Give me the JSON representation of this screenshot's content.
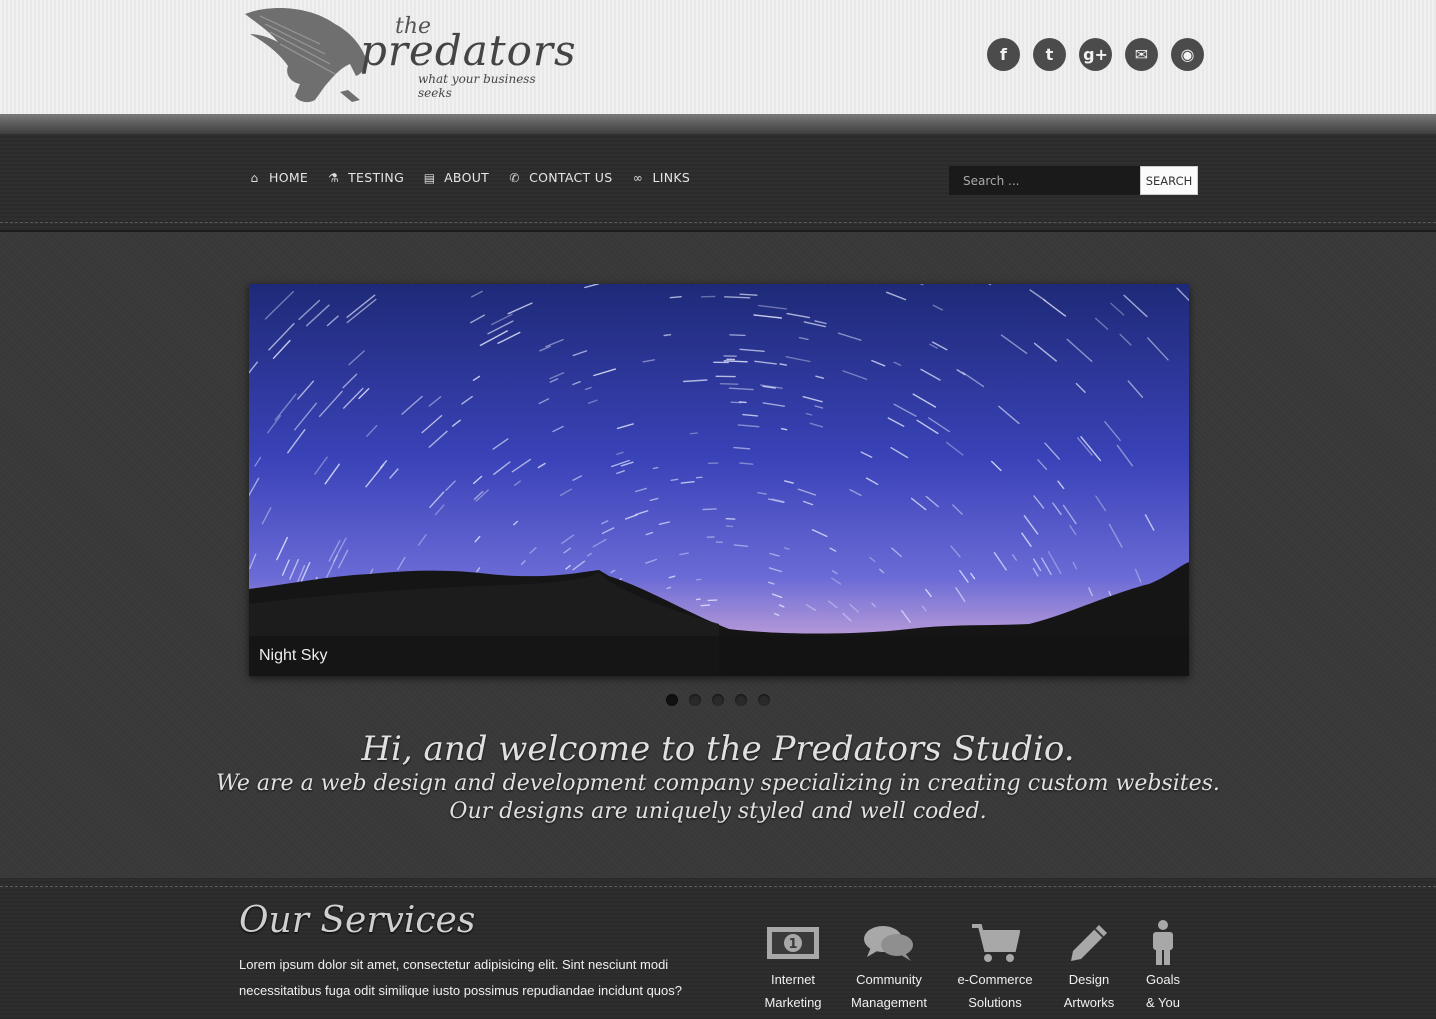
{
  "logo": {
    "the": "the",
    "name": "predators",
    "tagline": "what your business seeks"
  },
  "social": [
    {
      "icon": "facebook-icon",
      "glyph": "f"
    },
    {
      "icon": "twitter-icon",
      "glyph": "t"
    },
    {
      "icon": "google-plus-icon",
      "glyph": "g+"
    },
    {
      "icon": "mail-icon",
      "glyph": "✉"
    },
    {
      "icon": "rss-icon",
      "glyph": "◉"
    }
  ],
  "nav": {
    "items": [
      {
        "label": "HOME",
        "icon": "home-icon"
      },
      {
        "label": "TESTING",
        "icon": "flask-icon"
      },
      {
        "label": "ABOUT",
        "icon": "book-icon"
      },
      {
        "label": "CONTACT US",
        "icon": "phone-icon"
      },
      {
        "label": "LINKS",
        "icon": "link-icon"
      }
    ]
  },
  "search": {
    "placeholder": "Search ...",
    "button": "SEARCH"
  },
  "slider": {
    "caption": "Night Sky",
    "slides": 5,
    "active": 1
  },
  "welcome": {
    "title": "Hi, and welcome to the Predators Studio.",
    "line1": "We are a web design and development company specializing in creating custom websites.",
    "line2": "Our designs are uniquely styled and well coded."
  },
  "services": {
    "title": "Our Services",
    "text": "Lorem ipsum dolor sit amet, consectetur adipisicing elit. Sint nesciunt modi necessitatibus fuga odit similique iusto possimus repudiandae incidunt quos?",
    "items": [
      {
        "line1": "Internet",
        "line2": "Marketing",
        "icon": "money-icon"
      },
      {
        "line1": "Community",
        "line2": "Management",
        "icon": "chat-icon"
      },
      {
        "line1": "e-Commerce",
        "line2": "Solutions",
        "icon": "cart-icon"
      },
      {
        "line1": "Design",
        "line2": "Artworks",
        "icon": "pencil-icon"
      },
      {
        "line1": "Goals",
        "line2": "& You",
        "icon": "person-icon"
      }
    ]
  },
  "colors": {
    "accent": "#e6e6e6",
    "header_bg": "#eeeeee",
    "nav_bg": "#2d2d2d",
    "main_bg": "#3a3a3a"
  }
}
